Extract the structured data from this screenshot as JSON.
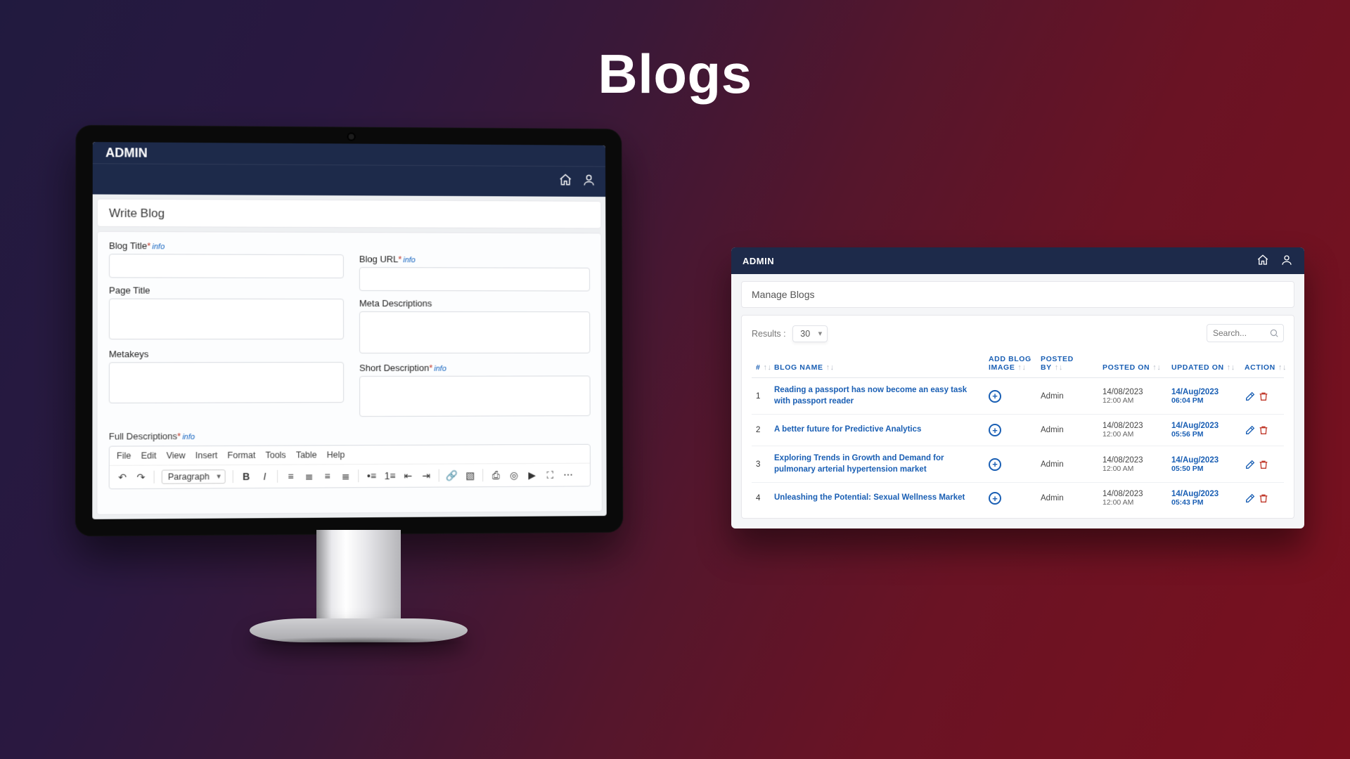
{
  "page": {
    "title": "Blogs"
  },
  "left": {
    "brand": "ADMIN",
    "panel_title": "Write Blog",
    "info_label": "info",
    "labels": {
      "blog_title": "Blog Title",
      "page_title": "Page Title",
      "metakeys": "Metakeys",
      "full_desc": "Full Descriptions",
      "blog_url": "Blog URL",
      "meta_desc": "Meta Descriptions",
      "short_desc": "Short Description"
    },
    "rte_menu": [
      "File",
      "Edit",
      "View",
      "Insert",
      "Format",
      "Tools",
      "Table",
      "Help"
    ],
    "rte_paragraph": "Paragraph"
  },
  "right": {
    "brand": "ADMIN",
    "panel_title": "Manage Blogs",
    "results_label": "Results :",
    "results_value": "30",
    "search_placeholder": "Search...",
    "columns": {
      "idx": "#",
      "name": "BLOG NAME",
      "img": "ADD BLOG IMAGE",
      "by": "POSTED BY",
      "pon": "POSTED ON",
      "uon": "UPDATED ON",
      "act": "ACTION"
    },
    "rows": [
      {
        "i": "1",
        "name": "Reading a passport has now become an easy task with passport reader",
        "by": "Admin",
        "pon_d": "14/08/2023",
        "pon_t": "12:00 AM",
        "uon_d": "14/Aug/2023",
        "uon_t": "06:04 PM"
      },
      {
        "i": "2",
        "name": "A better future for Predictive Analytics",
        "by": "Admin",
        "pon_d": "14/08/2023",
        "pon_t": "12:00 AM",
        "uon_d": "14/Aug/2023",
        "uon_t": "05:56 PM"
      },
      {
        "i": "3",
        "name": "Exploring Trends in Growth and Demand for pulmonary arterial hypertension market",
        "by": "Admin",
        "pon_d": "14/08/2023",
        "pon_t": "12:00 AM",
        "uon_d": "14/Aug/2023",
        "uon_t": "05:50 PM"
      },
      {
        "i": "4",
        "name": "Unleashing the Potential: Sexual Wellness Market",
        "by": "Admin",
        "pon_d": "14/08/2023",
        "pon_t": "12:00 AM",
        "uon_d": "14/Aug/2023",
        "uon_t": "05:43 PM"
      }
    ]
  }
}
